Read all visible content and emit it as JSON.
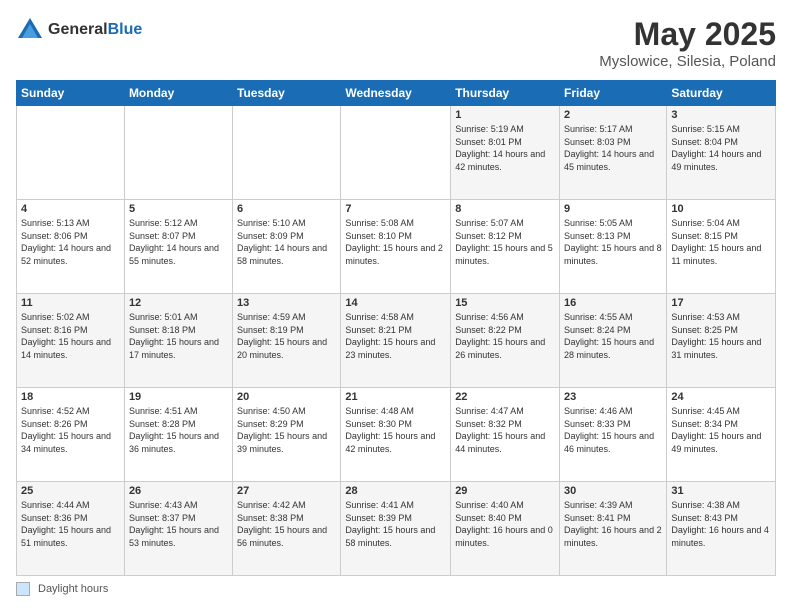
{
  "header": {
    "logo_general": "General",
    "logo_blue": "Blue",
    "title": "May 2025",
    "subtitle": "Myslowice, Silesia, Poland"
  },
  "legend": {
    "color_label": "Daylight hours"
  },
  "weekdays": [
    "Sunday",
    "Monday",
    "Tuesday",
    "Wednesday",
    "Thursday",
    "Friday",
    "Saturday"
  ],
  "weeks": [
    [
      {
        "day": "",
        "info": ""
      },
      {
        "day": "",
        "info": ""
      },
      {
        "day": "",
        "info": ""
      },
      {
        "day": "",
        "info": ""
      },
      {
        "day": "1",
        "info": "Sunrise: 5:19 AM\nSunset: 8:01 PM\nDaylight: 14 hours and 42 minutes."
      },
      {
        "day": "2",
        "info": "Sunrise: 5:17 AM\nSunset: 8:03 PM\nDaylight: 14 hours and 45 minutes."
      },
      {
        "day": "3",
        "info": "Sunrise: 5:15 AM\nSunset: 8:04 PM\nDaylight: 14 hours and 49 minutes."
      }
    ],
    [
      {
        "day": "4",
        "info": "Sunrise: 5:13 AM\nSunset: 8:06 PM\nDaylight: 14 hours and 52 minutes."
      },
      {
        "day": "5",
        "info": "Sunrise: 5:12 AM\nSunset: 8:07 PM\nDaylight: 14 hours and 55 minutes."
      },
      {
        "day": "6",
        "info": "Sunrise: 5:10 AM\nSunset: 8:09 PM\nDaylight: 14 hours and 58 minutes."
      },
      {
        "day": "7",
        "info": "Sunrise: 5:08 AM\nSunset: 8:10 PM\nDaylight: 15 hours and 2 minutes."
      },
      {
        "day": "8",
        "info": "Sunrise: 5:07 AM\nSunset: 8:12 PM\nDaylight: 15 hours and 5 minutes."
      },
      {
        "day": "9",
        "info": "Sunrise: 5:05 AM\nSunset: 8:13 PM\nDaylight: 15 hours and 8 minutes."
      },
      {
        "day": "10",
        "info": "Sunrise: 5:04 AM\nSunset: 8:15 PM\nDaylight: 15 hours and 11 minutes."
      }
    ],
    [
      {
        "day": "11",
        "info": "Sunrise: 5:02 AM\nSunset: 8:16 PM\nDaylight: 15 hours and 14 minutes."
      },
      {
        "day": "12",
        "info": "Sunrise: 5:01 AM\nSunset: 8:18 PM\nDaylight: 15 hours and 17 minutes."
      },
      {
        "day": "13",
        "info": "Sunrise: 4:59 AM\nSunset: 8:19 PM\nDaylight: 15 hours and 20 minutes."
      },
      {
        "day": "14",
        "info": "Sunrise: 4:58 AM\nSunset: 8:21 PM\nDaylight: 15 hours and 23 minutes."
      },
      {
        "day": "15",
        "info": "Sunrise: 4:56 AM\nSunset: 8:22 PM\nDaylight: 15 hours and 26 minutes."
      },
      {
        "day": "16",
        "info": "Sunrise: 4:55 AM\nSunset: 8:24 PM\nDaylight: 15 hours and 28 minutes."
      },
      {
        "day": "17",
        "info": "Sunrise: 4:53 AM\nSunset: 8:25 PM\nDaylight: 15 hours and 31 minutes."
      }
    ],
    [
      {
        "day": "18",
        "info": "Sunrise: 4:52 AM\nSunset: 8:26 PM\nDaylight: 15 hours and 34 minutes."
      },
      {
        "day": "19",
        "info": "Sunrise: 4:51 AM\nSunset: 8:28 PM\nDaylight: 15 hours and 36 minutes."
      },
      {
        "day": "20",
        "info": "Sunrise: 4:50 AM\nSunset: 8:29 PM\nDaylight: 15 hours and 39 minutes."
      },
      {
        "day": "21",
        "info": "Sunrise: 4:48 AM\nSunset: 8:30 PM\nDaylight: 15 hours and 42 minutes."
      },
      {
        "day": "22",
        "info": "Sunrise: 4:47 AM\nSunset: 8:32 PM\nDaylight: 15 hours and 44 minutes."
      },
      {
        "day": "23",
        "info": "Sunrise: 4:46 AM\nSunset: 8:33 PM\nDaylight: 15 hours and 46 minutes."
      },
      {
        "day": "24",
        "info": "Sunrise: 4:45 AM\nSunset: 8:34 PM\nDaylight: 15 hours and 49 minutes."
      }
    ],
    [
      {
        "day": "25",
        "info": "Sunrise: 4:44 AM\nSunset: 8:36 PM\nDaylight: 15 hours and 51 minutes."
      },
      {
        "day": "26",
        "info": "Sunrise: 4:43 AM\nSunset: 8:37 PM\nDaylight: 15 hours and 53 minutes."
      },
      {
        "day": "27",
        "info": "Sunrise: 4:42 AM\nSunset: 8:38 PM\nDaylight: 15 hours and 56 minutes."
      },
      {
        "day": "28",
        "info": "Sunrise: 4:41 AM\nSunset: 8:39 PM\nDaylight: 15 hours and 58 minutes."
      },
      {
        "day": "29",
        "info": "Sunrise: 4:40 AM\nSunset: 8:40 PM\nDaylight: 16 hours and 0 minutes."
      },
      {
        "day": "30",
        "info": "Sunrise: 4:39 AM\nSunset: 8:41 PM\nDaylight: 16 hours and 2 minutes."
      },
      {
        "day": "31",
        "info": "Sunrise: 4:38 AM\nSunset: 8:43 PM\nDaylight: 16 hours and 4 minutes."
      }
    ]
  ]
}
